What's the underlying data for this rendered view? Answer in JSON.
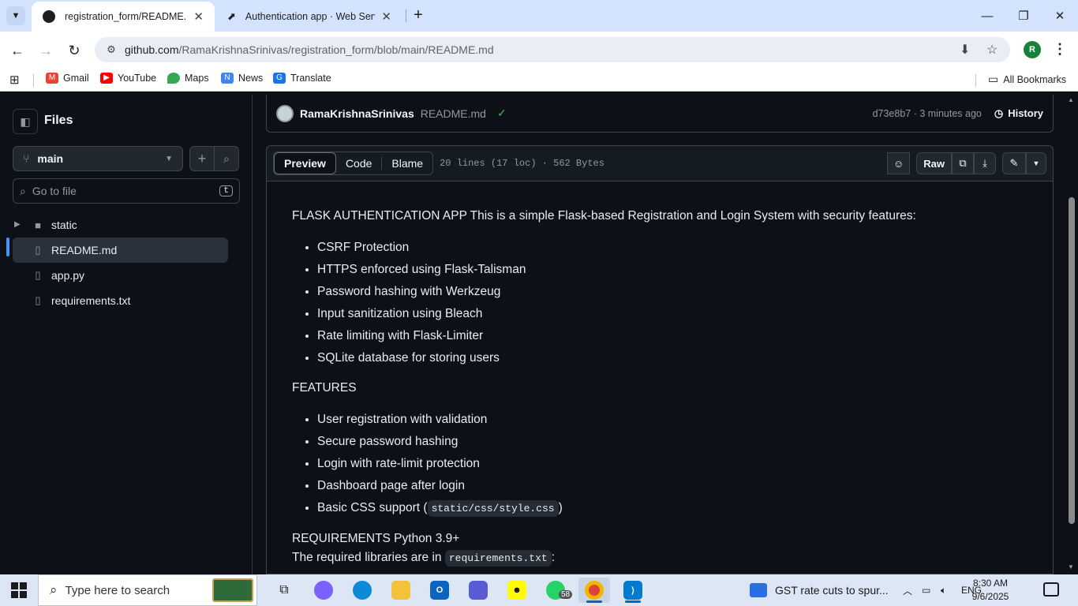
{
  "browser": {
    "tabs": [
      {
        "title": "registration_form/README.md",
        "active": true
      },
      {
        "title": "Authentication app · Web Servi",
        "active": false
      }
    ],
    "url_host": "github.com",
    "url_path": "/RamaKrishnaSrinivas/registration_form/blob/main/README.md",
    "bookmarks": [
      "Gmail",
      "YouTube",
      "Maps",
      "News",
      "Translate"
    ],
    "all_bookmarks": "All Bookmarks",
    "profile_initial": "R"
  },
  "sidebar": {
    "title": "Files",
    "branch": "main",
    "go_to_file": "Go to file",
    "go_to_file_key": "t",
    "tree": [
      {
        "name": "static",
        "type": "folder"
      },
      {
        "name": "README.md",
        "type": "file",
        "selected": true
      },
      {
        "name": "app.py",
        "type": "file"
      },
      {
        "name": "requirements.txt",
        "type": "file"
      }
    ]
  },
  "commit": {
    "author": "RamaKrishnaSrinivas",
    "message": "README.md",
    "hash_time": "d73e8b7 · 3 minutes ago",
    "history": "History"
  },
  "file_header": {
    "tabs": [
      "Preview",
      "Code",
      "Blame"
    ],
    "active_tab": "Preview",
    "meta": "20 lines (17 loc) · 562 Bytes",
    "raw": "Raw"
  },
  "readme": {
    "intro": "FLASK AUTHENTICATION APP This is a simple Flask-based Registration and Login System with security features:",
    "security_features": [
      "CSRF Protection",
      "HTTPS enforced using Flask-Talisman",
      "Password hashing with Werkzeug",
      "Input sanitization using Bleach",
      "Rate limiting with Flask-Limiter",
      "SQLite database for storing users"
    ],
    "features_heading": "FEATURES",
    "features": [
      "User registration with validation",
      "Secure password hashing",
      "Login with rate-limit protection",
      "Dashboard page after login"
    ],
    "css_item_prefix": "Basic CSS support (",
    "css_item_code": "static/css/style.css",
    "css_item_suffix": ")",
    "requirements_line": "REQUIREMENTS Python 3.9+",
    "libraries_prefix": "The required libraries are in",
    "libraries_code": "requirements.txt",
    "libraries_suffix": ":"
  },
  "taskbar": {
    "search_placeholder": "Type here to search",
    "whatsapp_badge": "58",
    "news": "GST rate cuts to spur...",
    "language": "ENG",
    "time": "8:30 AM",
    "date": "9/6/2025"
  },
  "colors": {
    "accent": "#4493f8",
    "success": "#3fb950",
    "bg": "#0d1117"
  }
}
